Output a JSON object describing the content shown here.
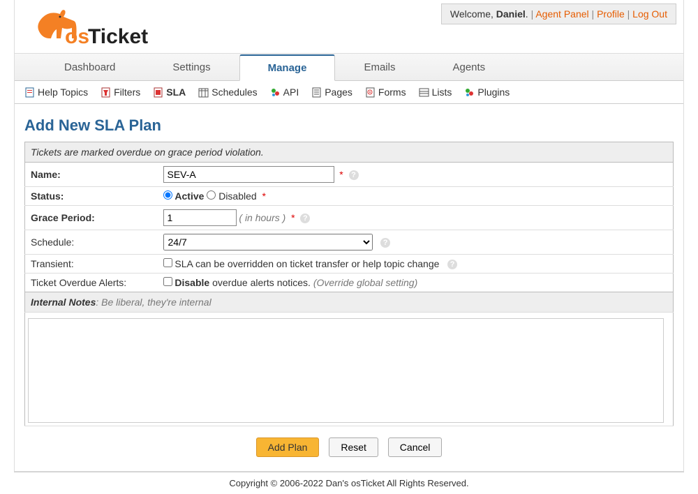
{
  "user_bar": {
    "welcome_prefix": "Welcome, ",
    "user_name": "Daniel",
    "period": ".",
    "agent_panel": "Agent Panel",
    "profile": "Profile",
    "logout": "Log Out"
  },
  "tabs": {
    "dashboard": "Dashboard",
    "settings": "Settings",
    "manage": "Manage",
    "emails": "Emails",
    "agents": "Agents"
  },
  "subnav": {
    "help_topics": "Help Topics",
    "filters": "Filters",
    "sla": "SLA",
    "schedules": "Schedules",
    "api": "API",
    "pages": "Pages",
    "forms": "Forms",
    "lists": "Lists",
    "plugins": "Plugins"
  },
  "title": "Add New SLA Plan",
  "form": {
    "instruction": "Tickets are marked overdue on grace period violation.",
    "name_label": "Name:",
    "name_value": "SEV-A",
    "status_label": "Status:",
    "status_active": "Active",
    "status_disabled": "Disabled",
    "grace_label": "Grace Period:",
    "grace_value": "1",
    "grace_hint": "( in hours )",
    "schedule_label": "Schedule:",
    "schedule_value": "24/7",
    "transient_label": "Transient:",
    "transient_text": "SLA can be overridden on ticket transfer or help topic change",
    "overdue_label": "Ticket Overdue Alerts:",
    "overdue_bold": "Disable",
    "overdue_rest": " overdue alerts notices. ",
    "overdue_hint": "(Override global setting)",
    "notes_label_bold": "Internal Notes",
    "notes_label_rest": ": Be liberal, they're internal"
  },
  "buttons": {
    "add": "Add Plan",
    "reset": "Reset",
    "cancel": "Cancel"
  },
  "footer": "Copyright © 2006-2022 Dan's osTicket All Rights Reserved."
}
